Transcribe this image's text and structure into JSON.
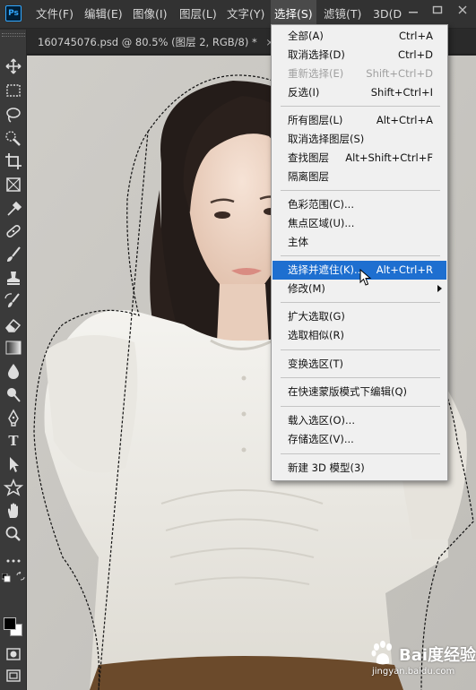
{
  "app": {
    "logo": "Ps"
  },
  "menubar": {
    "items": [
      "文件(F)",
      "编辑(E)",
      "图像(I)",
      "图层(L)",
      "文字(Y)",
      "选择(S)",
      "滤镜(T)",
      "3D(D"
    ]
  },
  "document": {
    "tab_title": "160745076.psd @ 80.5% (图层 2, RGB/8) *",
    "close": "×"
  },
  "toolbar": {
    "tools": [
      "move-tool",
      "marquee-tool",
      "lasso-tool",
      "quick-selection-tool",
      "crop-tool",
      "frame-tool",
      "eyedropper-tool",
      "healing-brush-tool",
      "brush-tool",
      "clone-stamp-tool",
      "history-brush-tool",
      "eraser-tool",
      "gradient-tool",
      "blur-tool",
      "dodge-tool",
      "pen-tool",
      "type-tool",
      "path-selection-tool",
      "shape-tool",
      "hand-tool",
      "zoom-tool",
      "edit-toolbar",
      "quick-mask",
      "screen-mode"
    ],
    "type_glyph": "T",
    "foreground_color": "#000000",
    "background_color": "#ffffff"
  },
  "select_menu": {
    "groups": [
      [
        {
          "label": "全部(A)",
          "shortcut": "Ctrl+A"
        },
        {
          "label": "取消选择(D)",
          "shortcut": "Ctrl+D"
        },
        {
          "label": "重新选择(E)",
          "shortcut": "Shift+Ctrl+D",
          "disabled": true
        },
        {
          "label": "反选(I)",
          "shortcut": "Shift+Ctrl+I"
        }
      ],
      [
        {
          "label": "所有图层(L)",
          "shortcut": "Alt+Ctrl+A"
        },
        {
          "label": "取消选择图层(S)",
          "shortcut": ""
        },
        {
          "label": "查找图层",
          "shortcut": "Alt+Shift+Ctrl+F"
        },
        {
          "label": "隔离图层",
          "shortcut": ""
        }
      ],
      [
        {
          "label": "色彩范围(C)...",
          "shortcut": ""
        },
        {
          "label": "焦点区域(U)...",
          "shortcut": ""
        },
        {
          "label": "主体",
          "shortcut": ""
        }
      ],
      [
        {
          "label": "选择并遮住(K)...",
          "shortcut": "Alt+Ctrl+R",
          "highlighted": true
        },
        {
          "label": "修改(M)",
          "shortcut": "",
          "submenu": true
        }
      ],
      [
        {
          "label": "扩大选取(G)",
          "shortcut": ""
        },
        {
          "label": "选取相似(R)",
          "shortcut": ""
        }
      ],
      [
        {
          "label": "变换选区(T)",
          "shortcut": ""
        }
      ],
      [
        {
          "label": "在快速蒙版模式下编辑(Q)",
          "shortcut": ""
        }
      ],
      [
        {
          "label": "载入选区(O)...",
          "shortcut": ""
        },
        {
          "label": "存储选区(V)...",
          "shortcut": ""
        }
      ],
      [
        {
          "label": "新建 3D 模型(3)",
          "shortcut": ""
        }
      ]
    ]
  },
  "watermark": {
    "brand": "Bai度经验",
    "url": "jingyan.baidu.com"
  },
  "colors": {
    "highlight": "#1e6fd0",
    "menu_bg": "#f0f0f0",
    "app_bg": "#323232"
  }
}
